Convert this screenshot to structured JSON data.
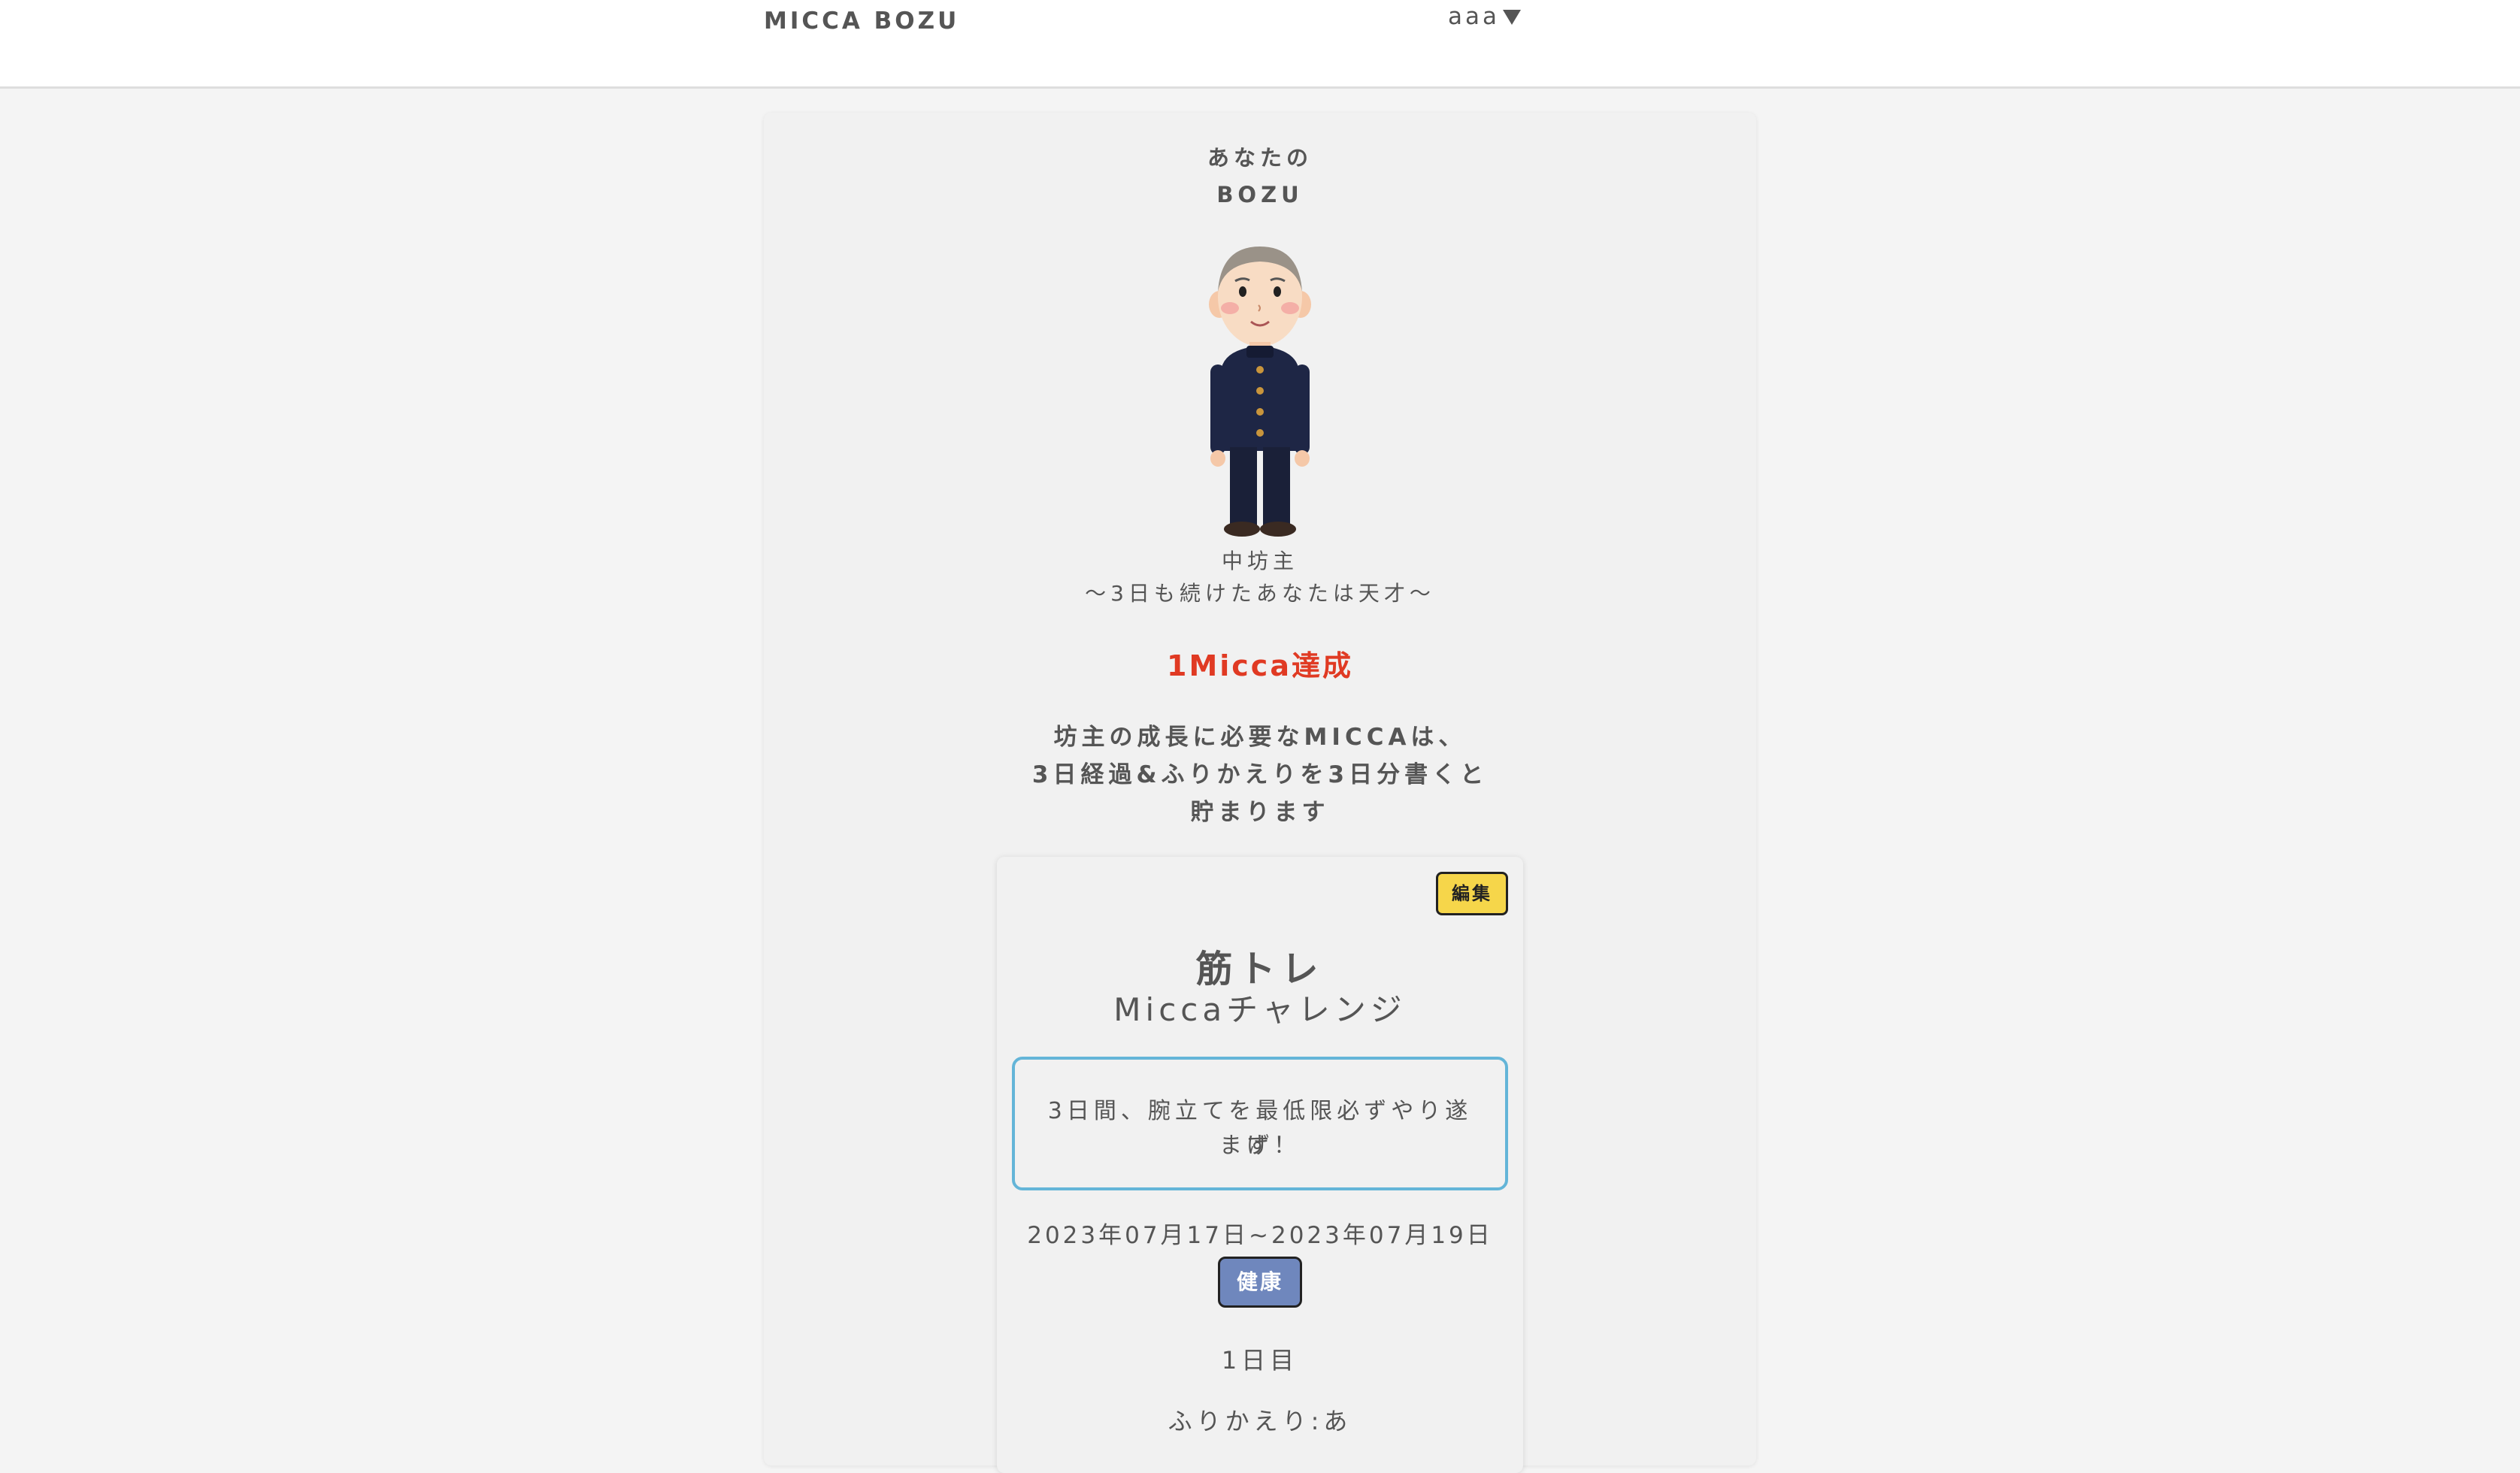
{
  "header": {
    "brand": "MICCA BOZU",
    "user_name": "aaa"
  },
  "bozu": {
    "heading_line1": "あなたの",
    "heading_line2": "BOZU",
    "rank_name": "中坊主",
    "rank_subtitle": "〜3日も続けたあなたは天才〜",
    "achievement": "1Micca達成",
    "explain_line1": "坊主の成長に必要なMICCAは、",
    "explain_line2": "3日経過&ふりかえりを3日分書くと",
    "explain_line3": "貯まります"
  },
  "challenge": {
    "edit_label": "編集",
    "title": "筋トレ",
    "subtitle": "Miccaチャレンジ",
    "goal_line1": "3日間、腕立てを最低限必ずやり遂げ",
    "goal_line2": "ます！",
    "period": "2023年07月17日~2023年07月19日",
    "category": "健康",
    "day": "1日目",
    "reflection": "ふりかえり:あ"
  },
  "colors": {
    "accent_red": "#e03a23",
    "edit_yellow": "#f6d64a",
    "goal_border": "#64b5d8",
    "category_blue": "#6f87bd"
  }
}
